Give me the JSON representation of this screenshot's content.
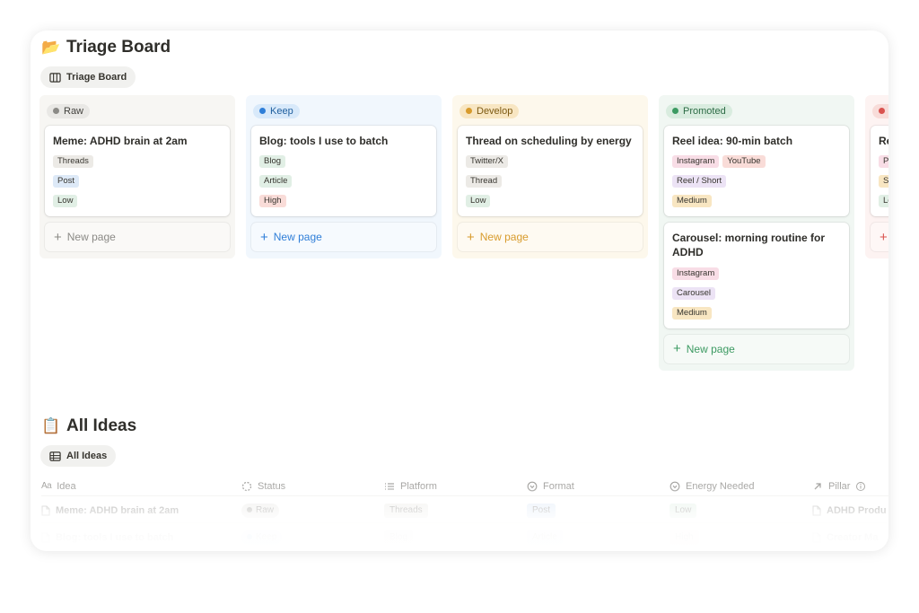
{
  "triage": {
    "icon": "folder-icon",
    "title": "Triage Board",
    "view_tab": "Triage Board"
  },
  "columns": [
    {
      "name": "Raw",
      "colors": {
        "bg": "#f7f6f3",
        "pill": "#e9e8e5",
        "dot": "#8b8a86",
        "pilltext": "#44433f",
        "newtext": "#8b8a86"
      },
      "new_page": "New page",
      "cards": [
        {
          "title": "Meme: ADHD brain at 2am",
          "tags": [
            [
              "Threads"
            ],
            [
              "Post"
            ],
            [
              "Low"
            ]
          ]
        }
      ]
    },
    {
      "name": "Keep",
      "colors": {
        "bg": "#f1f7fd",
        "pill": "#d8e9fa",
        "dot": "#2f7ed8",
        "pilltext": "#1f5f9e",
        "newtext": "#2f7ed8"
      },
      "new_page": "New page",
      "cards": [
        {
          "title": "Blog: tools I use to batch",
          "tags": [
            [
              "Blog"
            ],
            [
              "Article"
            ],
            [
              "High"
            ]
          ]
        }
      ]
    },
    {
      "name": "Develop",
      "colors": {
        "bg": "#fdf8ec",
        "pill": "#f8e6c2",
        "dot": "#d89b2c",
        "pilltext": "#7d5a12",
        "newtext": "#d89b2c"
      },
      "new_page": "New page",
      "cards": [
        {
          "title": "Thread on scheduling by energy",
          "tags": [
            [
              "Twitter/X"
            ],
            [
              "Thread"
            ],
            [
              "Low"
            ]
          ]
        }
      ]
    },
    {
      "name": "Promoted",
      "colors": {
        "bg": "#f1f7f3",
        "pill": "#d9ecdf",
        "dot": "#3c9a62",
        "pilltext": "#2c6b45",
        "newtext": "#3c9a62"
      },
      "new_page": "New page",
      "cards": [
        {
          "title": "Reel idea: 90-min batch",
          "tags": [
            [
              "Instagram",
              "YouTube"
            ],
            [
              "Reel / Short"
            ],
            [
              "Medium"
            ]
          ]
        },
        {
          "title": "Carousel: morning routine for ADHD",
          "tags": [
            [
              "Instagram"
            ],
            [
              "Carousel"
            ],
            [
              "Medium"
            ]
          ]
        }
      ]
    },
    {
      "name": "D",
      "colors": {
        "bg": "#fdf3f2",
        "pill": "#f8dcd9",
        "dot": "#d9534f",
        "pilltext": "#8e2e2a",
        "newtext": "#d9534f"
      },
      "new_page": "",
      "cards": [
        {
          "title": "Re",
          "tags": [
            [
              "Pi"
            ],
            [
              "St"
            ],
            [
              "Lo"
            ]
          ]
        }
      ]
    }
  ],
  "tag_colors": {
    "Threads": "#eceae6",
    "Post": "#dde9f7",
    "Low": "#e1efe5",
    "Blog": "#e1efe5",
    "Article": "#e1efe5",
    "High": "#f9dcd8",
    "Twitter/X": "#eceae6",
    "Thread": "#eceae6",
    "Instagram": "#f8dde6",
    "YouTube": "#f9dcd8",
    "Reel / Short": "#ece3f5",
    "Medium": "#f8e6c2",
    "Carousel": "#ece3f5",
    "Pi": "#f8dde6",
    "St": "#f8e6c2",
    "Lo": "#e1efe5"
  },
  "all_ideas": {
    "icon": "clipboard-icon",
    "title": "All Ideas",
    "view_tab": "All Ideas",
    "columns": [
      "Idea",
      "Status",
      "Platform",
      "Format",
      "Energy Needed",
      "Pillar"
    ],
    "rows": [
      {
        "title": "Meme: ADHD brain at 2am",
        "status": "Raw",
        "platform": "Threads",
        "format": "Post",
        "energy": "Low",
        "pillar": "ADHD Produ"
      },
      {
        "title": "Blog: tools I use to batch",
        "status": "Keep",
        "platform": "Blog",
        "format": "Article",
        "energy": "High",
        "pillar": "Creator Ma"
      }
    ]
  }
}
